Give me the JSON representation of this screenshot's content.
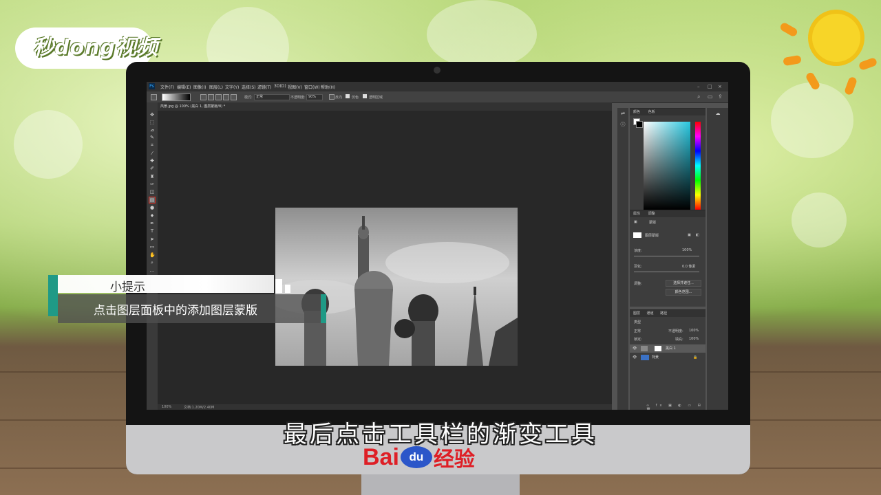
{
  "branding": {
    "logo_text": "秒dong视频"
  },
  "photoshop": {
    "menu": [
      "文件(F)",
      "编辑(E)",
      "图像(I)",
      "图层(L)",
      "文字(Y)",
      "选择(S)",
      "滤镜(T)",
      "3D(D)",
      "视图(V)",
      "窗口(W)",
      "帮助(H)"
    ],
    "options": {
      "mode_label": "模式:",
      "mode_value": "正常",
      "opacity_label": "不透明度:",
      "opacity_value": "90%",
      "reverse_label": "反向",
      "dither_label": "仿色",
      "transparency_label": "透明区域"
    },
    "doc_tab": "风景.jpg @ 100% (黑白 1, 图层蒙版/8) *",
    "status": {
      "zoom": "100%",
      "doc_info": "文档:1.20M/2.40M"
    },
    "color_panel": {
      "tab1": "颜色",
      "tab2": "色板"
    },
    "properties_panel": {
      "tab1": "属性",
      "tab2": "调整",
      "mask_label": "蒙版",
      "layer_mask_label": "图层蒙版",
      "density_label": "浓度:",
      "density_value": "100%",
      "feather_label": "羽化:",
      "feather_value": "0.0 像素",
      "adjust_label": "调整:",
      "select_mask_button": "选择并遮住...",
      "color_range_button": "颜色范围..."
    },
    "layers_panel": {
      "tabs": [
        "图层",
        "通道",
        "路径"
      ],
      "kind_label": "类型",
      "blend_mode": "正常",
      "opacity_label": "不透明度:",
      "opacity_value": "100%",
      "lock_label": "锁定:",
      "fill_label": "填充:",
      "fill_value": "100%",
      "layers": [
        {
          "name": "黑白 1"
        },
        {
          "name": "背景"
        }
      ]
    }
  },
  "tip": {
    "title": "小提示",
    "body": "点击图层面板中的添加图层蒙版"
  },
  "subtitle": "最后点击工具栏的渐变工具",
  "footer_brand": {
    "bai": "Bai",
    "du": "du",
    "jingyan": "经验"
  },
  "colors": {
    "accent_teal": "#1f9a86",
    "baidu_red": "#de1f26",
    "baidu_blue": "#2b56c9",
    "highlight_red": "#e0281e"
  }
}
